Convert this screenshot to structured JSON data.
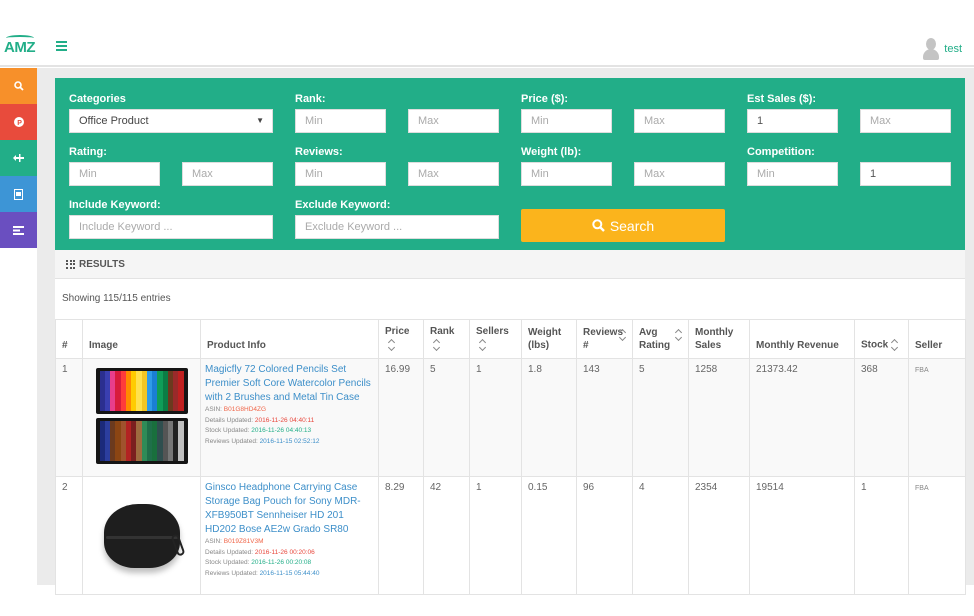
{
  "header": {
    "logo_text": "AMZ",
    "username": "test"
  },
  "sidenav": [
    {
      "icon": "search-icon",
      "color": "#f7902a",
      "glyph": "🔍"
    },
    {
      "icon": "product-hunt-icon",
      "color": "#e84b3c",
      "glyph": "P"
    },
    {
      "icon": "plane-icon",
      "color": "#22ae88",
      "glyph": "✈"
    },
    {
      "icon": "document-icon",
      "color": "#3d95d6",
      "glyph": "▤"
    },
    {
      "icon": "list-icon",
      "color": "#6a4fc0",
      "glyph": "☰"
    }
  ],
  "filters": {
    "categories_label": "Categories",
    "categories_value": "Office Product",
    "rank_label": "Rank:",
    "price_label": "Price ($):",
    "est_sales_label": "Est Sales ($):",
    "rating_label": "Rating:",
    "reviews_label": "Reviews:",
    "weight_label": "Weight (lb):",
    "competition_label": "Competition:",
    "include_label": "Include Keyword:",
    "exclude_label": "Exclude Keyword:",
    "min_placeholder": "Min",
    "max_placeholder": "Max",
    "include_placeholder": "Include Keyword ...",
    "exclude_placeholder": "Exclude Keyword ...",
    "est_sales_min_value": "1",
    "competition_max_value": "1",
    "search_label": "Search"
  },
  "results": {
    "heading": "RESULTS",
    "showing": "Showing 115/115 entries",
    "columns": [
      "#",
      "Image",
      "Product Info",
      "Price",
      "Rank",
      "Sellers",
      "Weight (lbs)",
      "Reviews #",
      "Avg Rating",
      "Monthly Sales",
      "Monthly Revenue",
      "Stock",
      "Seller"
    ],
    "rows": [
      {
        "index": "1",
        "image": "colored-pencils-set",
        "title": "Magicfly 72 Colored Pencils Set Premier Soft Core Watercolor Pencils with 2 Brushes and Metal Tin Case",
        "asin_label": "ASIN:",
        "asin": "B01G8HD4ZG",
        "details_label": "Details Updated:",
        "details_updated": "2016-11-26 04:40:11",
        "stock_label": "Stock Updated:",
        "stock_updated": "2016-11-26 04:40:13",
        "reviews_label": "Reviews Updated:",
        "reviews_updated": "2016-11-15 02:52:12",
        "price": "16.99",
        "rank": "5",
        "sellers": "1",
        "weight": "1.8",
        "reviews": "143",
        "avg_rating": "5",
        "monthly_sales": "1258",
        "monthly_revenue": "21373.42",
        "stock": "368",
        "seller": "FBA"
      },
      {
        "index": "2",
        "image": "headphone-case",
        "title": "Ginsco Headphone Carrying Case Storage Bag Pouch for Sony MDR-XFB950BT Sennheiser HD 201 HD202 Bose AE2w Grado SR80",
        "asin_label": "ASIN:",
        "asin": "B019Z81V3M",
        "details_label": "Details Updated:",
        "details_updated": "2016-11-26 00:20:06",
        "stock_label": "Stock Updated:",
        "stock_updated": "2016-11-26 00:20:08",
        "reviews_label": "Reviews Updated:",
        "reviews_updated": "2016-11-15 05:44:40",
        "price": "8.29",
        "rank": "42",
        "sellers": "1",
        "weight": "0.15",
        "reviews": "96",
        "avg_rating": "4",
        "monthly_sales": "2354",
        "monthly_revenue": "19514",
        "stock": "1",
        "seller": "FBA"
      }
    ]
  },
  "colors": {
    "brand": "#22ae88",
    "search_button": "#fbb41c",
    "link": "#3d8fc9"
  }
}
